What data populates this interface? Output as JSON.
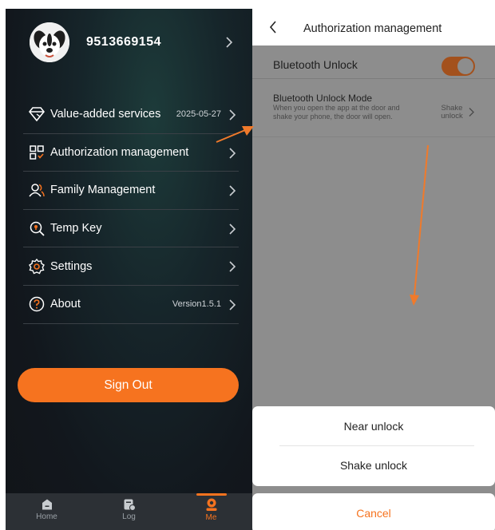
{
  "left": {
    "profile": {
      "phone": "9513669154"
    },
    "menu": [
      {
        "id": "value-added-services",
        "label": "Value-added services",
        "value": "2025-05-27",
        "icon": "diamond-icon"
      },
      {
        "id": "authorization-management",
        "label": "Authorization management",
        "value": "",
        "icon": "grid-icon"
      },
      {
        "id": "family-management",
        "label": "Family Management",
        "value": "",
        "icon": "people-icon"
      },
      {
        "id": "temp-key",
        "label": "Temp Key",
        "value": "",
        "icon": "magnifier-key-icon"
      },
      {
        "id": "settings",
        "label": "Settings",
        "value": "",
        "icon": "gear-icon"
      },
      {
        "id": "about",
        "label": "About",
        "value": "Version1.5.1",
        "icon": "question-icon"
      }
    ],
    "sign_out_label": "Sign Out",
    "tabs": [
      {
        "label": "Home",
        "icon": "home-icon",
        "active": false
      },
      {
        "label": "Log",
        "icon": "log-icon",
        "active": false
      },
      {
        "label": "Me",
        "icon": "person-icon",
        "active": true
      }
    ]
  },
  "right": {
    "title": "Authorization management",
    "bluetooth_unlock": {
      "label": "Bluetooth Unlock",
      "enabled": true
    },
    "unlock_mode": {
      "title": "Bluetooth Unlock Mode",
      "description": "When you open the app at the door and shake your phone, the door will open.",
      "value": "Shake unlock"
    },
    "sheet": {
      "options": [
        "Near unlock",
        "Shake unlock"
      ],
      "cancel_label": "Cancel"
    }
  },
  "colors": {
    "accent": "#f6731f",
    "dark_bg": "#12171d",
    "tabbar_bg": "#2c3035",
    "overlay": "#8d8d8d"
  }
}
